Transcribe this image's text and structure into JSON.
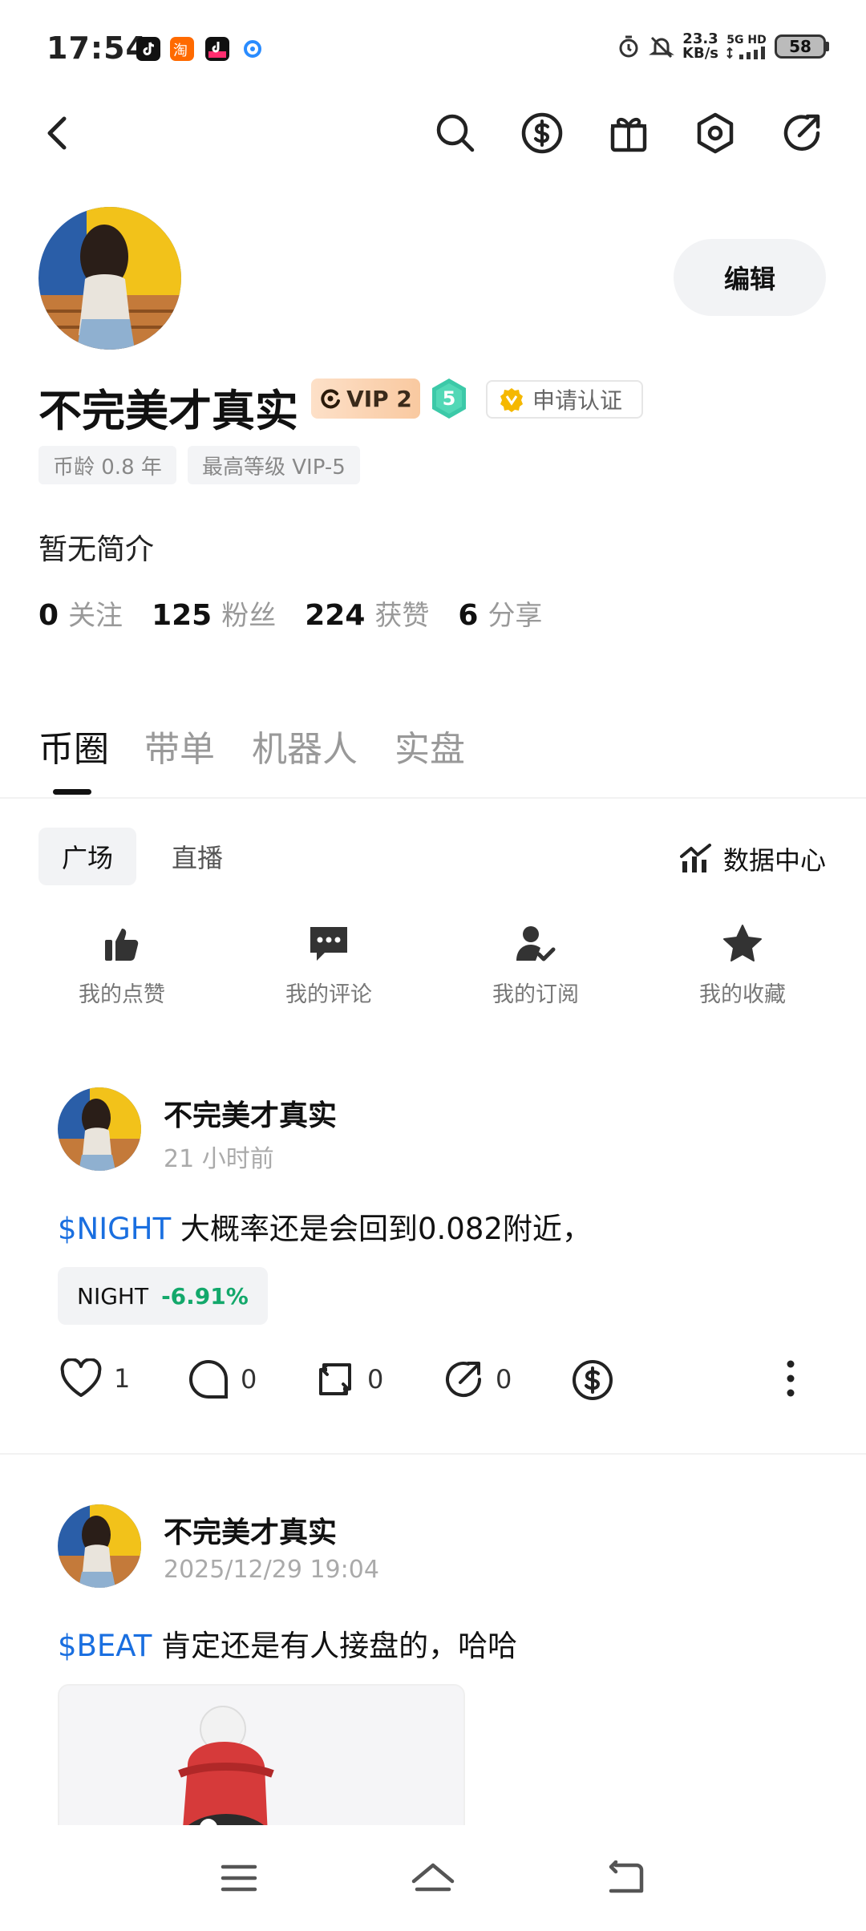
{
  "status_bar": {
    "time": "17:54",
    "speed_value": "23.3",
    "speed_unit": "KB/s",
    "network_top": "5G HD",
    "battery": "58"
  },
  "profile": {
    "name": "不完美才真实",
    "vip_label": "VIP 2",
    "level": "5",
    "verify_label": "申请认证",
    "edit_label": "编辑",
    "tags": [
      "币龄 0.8 年",
      "最高等级 VIP-5"
    ],
    "bio": "暂无简介",
    "stats": [
      {
        "value": "0",
        "label": "关注"
      },
      {
        "value": "125",
        "label": "粉丝"
      },
      {
        "value": "224",
        "label": "获赞"
      },
      {
        "value": "6",
        "label": "分享"
      }
    ]
  },
  "tabs": [
    "币圈",
    "带单",
    "机器人",
    "实盘"
  ],
  "active_tab": "币圈",
  "subtabs": [
    "广场",
    "直播"
  ],
  "data_center_label": "数据中心",
  "quick_actions": [
    {
      "label": "我的点赞",
      "icon": "thumbs-up-icon"
    },
    {
      "label": "我的评论",
      "icon": "comment-icon"
    },
    {
      "label": "我的订阅",
      "icon": "subscribe-user-icon"
    },
    {
      "label": "我的收藏",
      "icon": "star-icon"
    }
  ],
  "posts": [
    {
      "author": "不完美才真实",
      "time": "21 小时前",
      "ticker": "$NIGHT",
      "text": " 大概率还是会回到0.082附近，",
      "chip_symbol": "NIGHT",
      "chip_change": "-6.91%",
      "likes": "1",
      "comments": "0",
      "reposts": "0",
      "shares": "0"
    },
    {
      "author": "不完美才真实",
      "time": "2025/12/29 19:04",
      "ticker": "$BEAT",
      "text": " 肯定还是有人接盘的，哈哈"
    }
  ],
  "colors": {
    "ticker_blue": "#1a6fe0",
    "change_green": "#13a86b",
    "vip_gradient": "#f9c9a0",
    "level_teal": "#3cc9a8"
  }
}
